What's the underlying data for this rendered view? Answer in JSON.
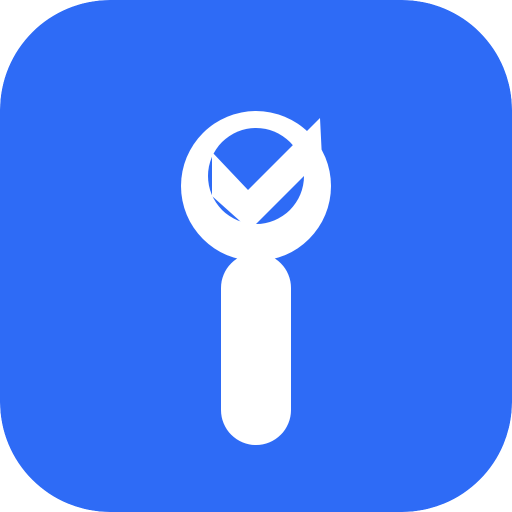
{
  "icon": {
    "name": "info-check-app-icon",
    "glyph": "info-with-checkmark",
    "colors": {
      "background": "#2E6BF6",
      "foreground": "#FFFFFF"
    }
  }
}
